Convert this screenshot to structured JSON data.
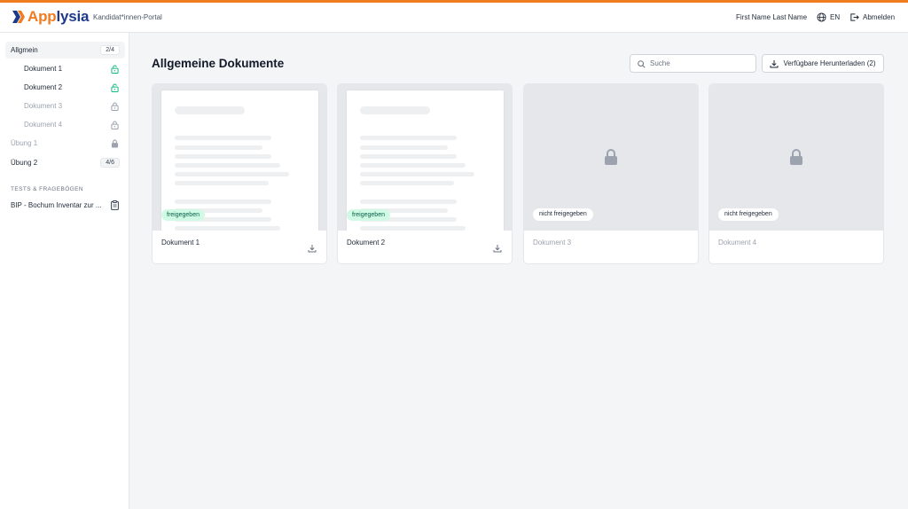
{
  "header": {
    "logo_part1": "App",
    "logo_part2": "lysia",
    "portal_label": "Kandidat*innen-Portal",
    "user_name": "First Name Last Name",
    "language": "EN",
    "logout_label": "Abmelden"
  },
  "sidebar": {
    "items": [
      {
        "label": "Allgmein",
        "badge": "2/4"
      },
      {
        "label": "Dokument 1",
        "status": "unlocked"
      },
      {
        "label": "Dokument 2",
        "status": "unlocked"
      },
      {
        "label": "Dokument 3",
        "status": "locked"
      },
      {
        "label": "Dokument 4",
        "status": "locked"
      },
      {
        "label": "Übung 1",
        "status": "locked"
      },
      {
        "label": "Übung 2",
        "badge": "4/6"
      }
    ],
    "section_title": "TESTS & FRAGEBÖGEN",
    "test_item": "BIP - Bochum Inventar zur ..."
  },
  "main": {
    "title": "Allgemeine Dokumente",
    "search_placeholder": "Suche",
    "download_button": "Verfügbare Herunterladen (2)",
    "cards": [
      {
        "name": "Dokument 1",
        "status": "freigegeben"
      },
      {
        "name": "Dokument 2",
        "status": "freigegeben"
      },
      {
        "name": "Dokument 3",
        "status": "nicht freigegeben"
      },
      {
        "name": "Dokument 4",
        "status": "nicht freigegeben"
      }
    ]
  },
  "colors": {
    "brand_orange": "#f07c20",
    "brand_navy": "#1e3a8a",
    "unlocked_green": "#10b981",
    "released_pill_bg": "#d1fae5"
  }
}
